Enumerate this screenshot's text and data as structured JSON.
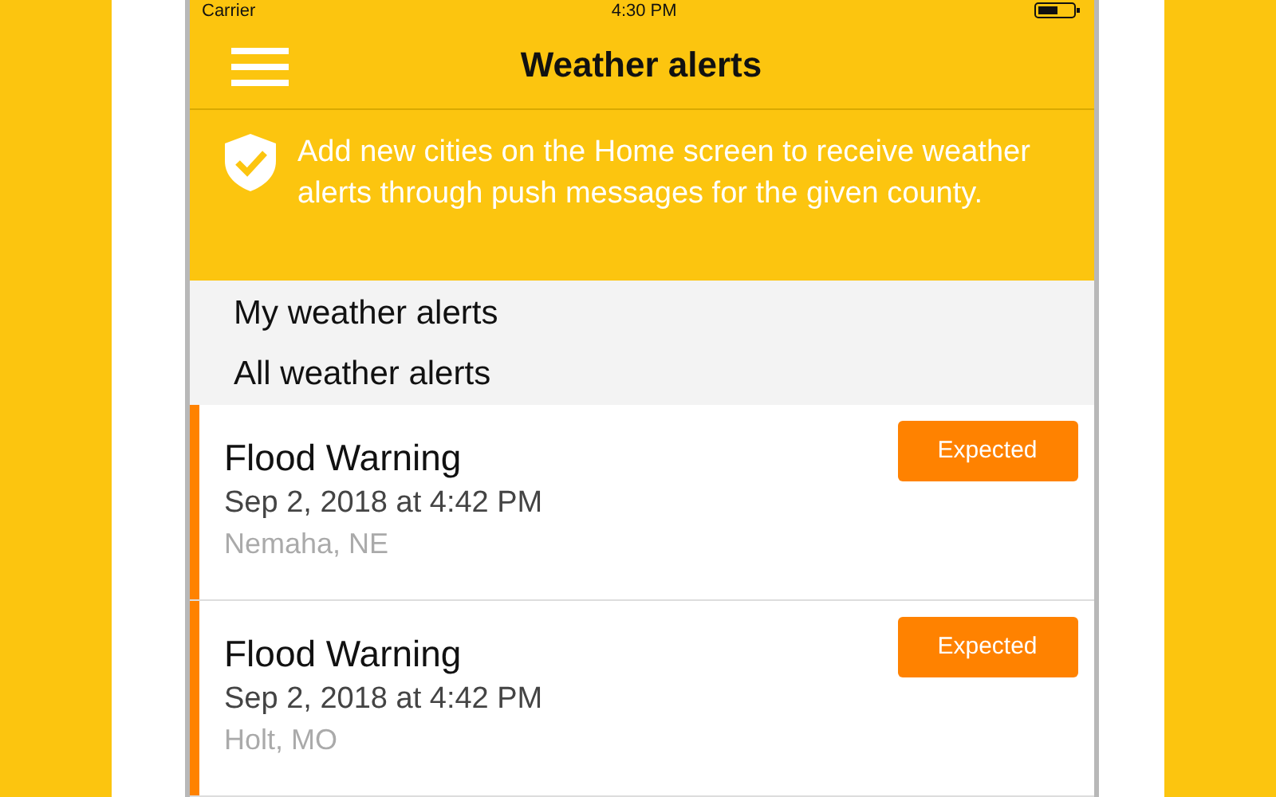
{
  "status_bar": {
    "carrier": "Carrier",
    "time": "4:30 PM"
  },
  "nav": {
    "title": "Weather alerts"
  },
  "banner": {
    "text": "Add new cities on the Home screen to receive weather alerts through push messages for the given county."
  },
  "sections": [
    "My weather alerts",
    "All weather alerts"
  ],
  "alerts": [
    {
      "title": "Flood Warning",
      "date": "Sep 2, 2018 at 4:42 PM",
      "location": "Nemaha, NE",
      "status": "Expected",
      "color": "#ff8200"
    },
    {
      "title": "Flood Warning",
      "date": "Sep 2, 2018 at 4:42 PM",
      "location": "Holt, MO",
      "status": "Expected",
      "color": "#ff8200"
    }
  ]
}
